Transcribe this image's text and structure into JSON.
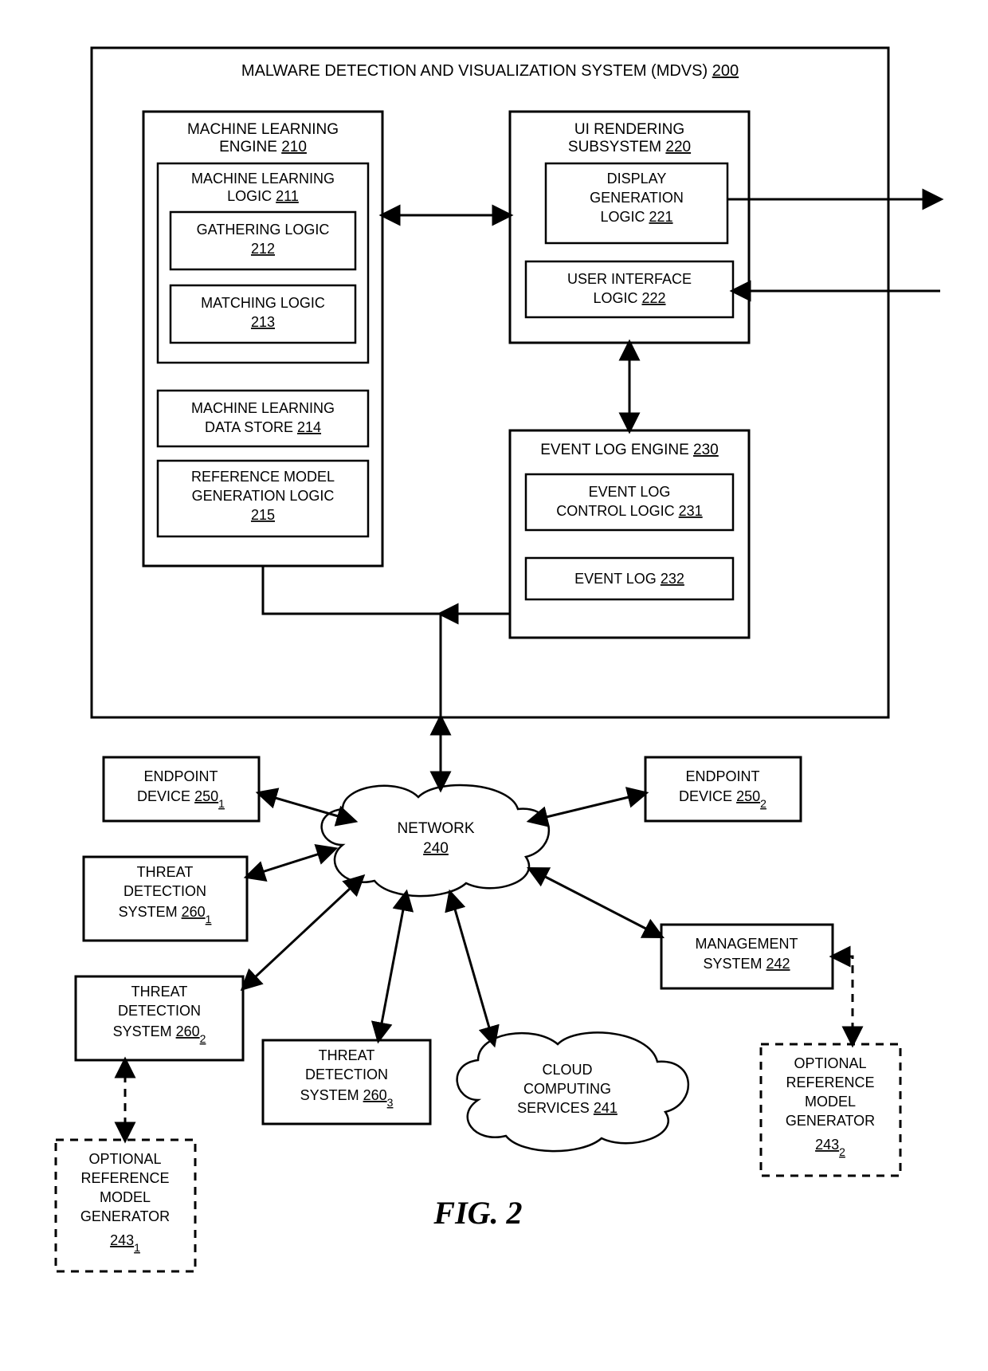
{
  "figure_label": "FIG. 2",
  "mdvs": {
    "title_l1": "MALWARE DETECTION AND VISUALIZATION SYSTEM (MDVS)",
    "ref": "200"
  },
  "ml_engine": {
    "title_l1": "MACHINE LEARNING",
    "title_l2": "ENGINE",
    "ref": "210"
  },
  "ml_logic": {
    "title_l1": "MACHINE LEARNING",
    "title_l2": "LOGIC",
    "ref": "211"
  },
  "gathering": {
    "title_l1": "GATHERING LOGIC",
    "ref": "212"
  },
  "matching": {
    "title_l1": "MATCHING LOGIC",
    "ref": "213"
  },
  "ml_store": {
    "title_l1": "MACHINE LEARNING",
    "title_l2": "DATA STORE",
    "ref": "214"
  },
  "refmodel": {
    "title_l1": "REFERENCE MODEL",
    "title_l2": "GENERATION LOGIC",
    "ref": "215"
  },
  "ui_sub": {
    "title_l1": "UI RENDERING",
    "title_l2": "SUBSYSTEM",
    "ref": "220"
  },
  "display_gen": {
    "title_l1": "DISPLAY",
    "title_l2": "GENERATION",
    "title_l3": "LOGIC",
    "ref": "221"
  },
  "ui_logic": {
    "title_l1": "USER INTERFACE",
    "title_l2": "LOGIC",
    "ref": "222"
  },
  "evt_engine": {
    "title": "EVENT LOG ENGINE",
    "ref": "230"
  },
  "evt_ctrl": {
    "title_l1": "EVENT LOG",
    "title_l2": "CONTROL LOGIC",
    "ref": "231"
  },
  "evt_log": {
    "title": "EVENT LOG",
    "ref": "232"
  },
  "network": {
    "title": "NETWORK",
    "ref": "240"
  },
  "cloud": {
    "title_l1": "CLOUD",
    "title_l2": "COMPUTING",
    "title_l3": "SERVICES",
    "ref": "241"
  },
  "endpoint1": {
    "title_l1": "ENDPOINT",
    "title_l2": "DEVICE",
    "refbase": "250",
    "refsub": "1"
  },
  "endpoint2": {
    "title_l1": "ENDPOINT",
    "title_l2": "DEVICE",
    "refbase": "250",
    "refsub": "2"
  },
  "threat1": {
    "title_l1": "THREAT",
    "title_l2": "DETECTION",
    "title_l3": "SYSTEM",
    "refbase": "260",
    "refsub": "1"
  },
  "threat2": {
    "title_l1": "THREAT",
    "title_l2": "DETECTION",
    "title_l3": "SYSTEM",
    "refbase": "260",
    "refsub": "2"
  },
  "threat3": {
    "title_l1": "THREAT",
    "title_l2": "DETECTION",
    "title_l3": "SYSTEM",
    "refbase": "260",
    "refsub": "3"
  },
  "mgmt": {
    "title_l1": "MANAGEMENT",
    "title_l2": "SYSTEM",
    "ref": "242"
  },
  "optref1": {
    "title_l1": "OPTIONAL",
    "title_l2": "REFERENCE",
    "title_l3": "MODEL",
    "title_l4": "GENERATOR",
    "refbase": "243",
    "refsub": "1"
  },
  "optref2": {
    "title_l1": "OPTIONAL",
    "title_l2": "REFERENCE",
    "title_l3": "MODEL",
    "title_l4": "GENERATOR",
    "refbase": "243",
    "refsub": "2"
  }
}
